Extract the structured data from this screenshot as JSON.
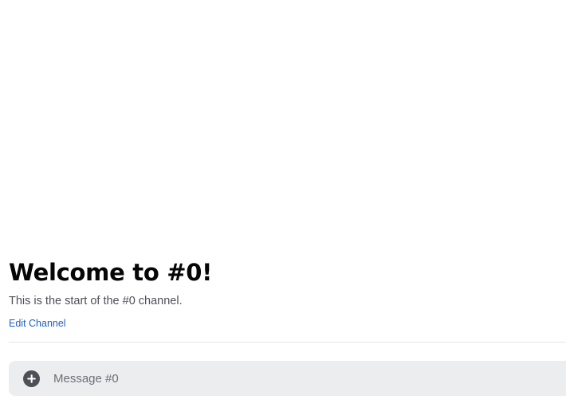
{
  "welcome": {
    "title": "Welcome to #0!",
    "subtitle": "This is the start of the #0 channel.",
    "edit_channel_label": "Edit Channel"
  },
  "composer": {
    "placeholder": "Message #0",
    "attach_icon": "plus-circle-icon"
  },
  "colors": {
    "background": "#ffffff",
    "title": "#060607",
    "subtitle": "#4e5058",
    "link": "#1f5fbf",
    "composer_bg": "#ebedef",
    "icon": "#4e5058"
  }
}
